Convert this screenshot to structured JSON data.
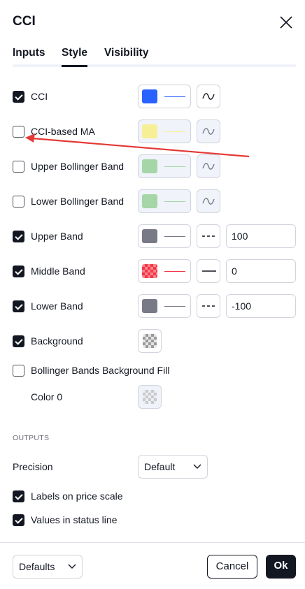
{
  "dialog": {
    "title": "CCI"
  },
  "tabs": [
    {
      "label": "Inputs"
    },
    {
      "label": "Style"
    },
    {
      "label": "Visibility"
    }
  ],
  "colors": {
    "blue": "#2962ff",
    "yellow": "#f7ef96",
    "green": "#a5d6a7",
    "gray": "#787b86",
    "red": "#f23645",
    "dark": "#131722"
  },
  "rows": [
    {
      "label": "CCI",
      "checked": true
    },
    {
      "label": "CCI-based MA",
      "checked": false
    },
    {
      "label": "Upper Bollinger Band",
      "checked": false
    },
    {
      "label": "Lower Bollinger Band",
      "checked": false
    },
    {
      "label": "Upper Band",
      "checked": true,
      "value": "100"
    },
    {
      "label": "Middle Band",
      "checked": true,
      "value": "0"
    },
    {
      "label": "Lower Band",
      "checked": true,
      "value": "-100"
    },
    {
      "label": "Background",
      "checked": true
    },
    {
      "label": "Bollinger Bands Background Fill",
      "checked": false
    },
    {
      "label": "Color 0"
    }
  ],
  "outputs": {
    "section_label": "OUTPUTS",
    "precision_label": "Precision",
    "precision_value": "Default",
    "labels_on_price_scale": "Labels on price scale",
    "values_in_status_line": "Values in status line"
  },
  "footer": {
    "defaults": "Defaults",
    "cancel": "Cancel",
    "ok": "Ok"
  }
}
